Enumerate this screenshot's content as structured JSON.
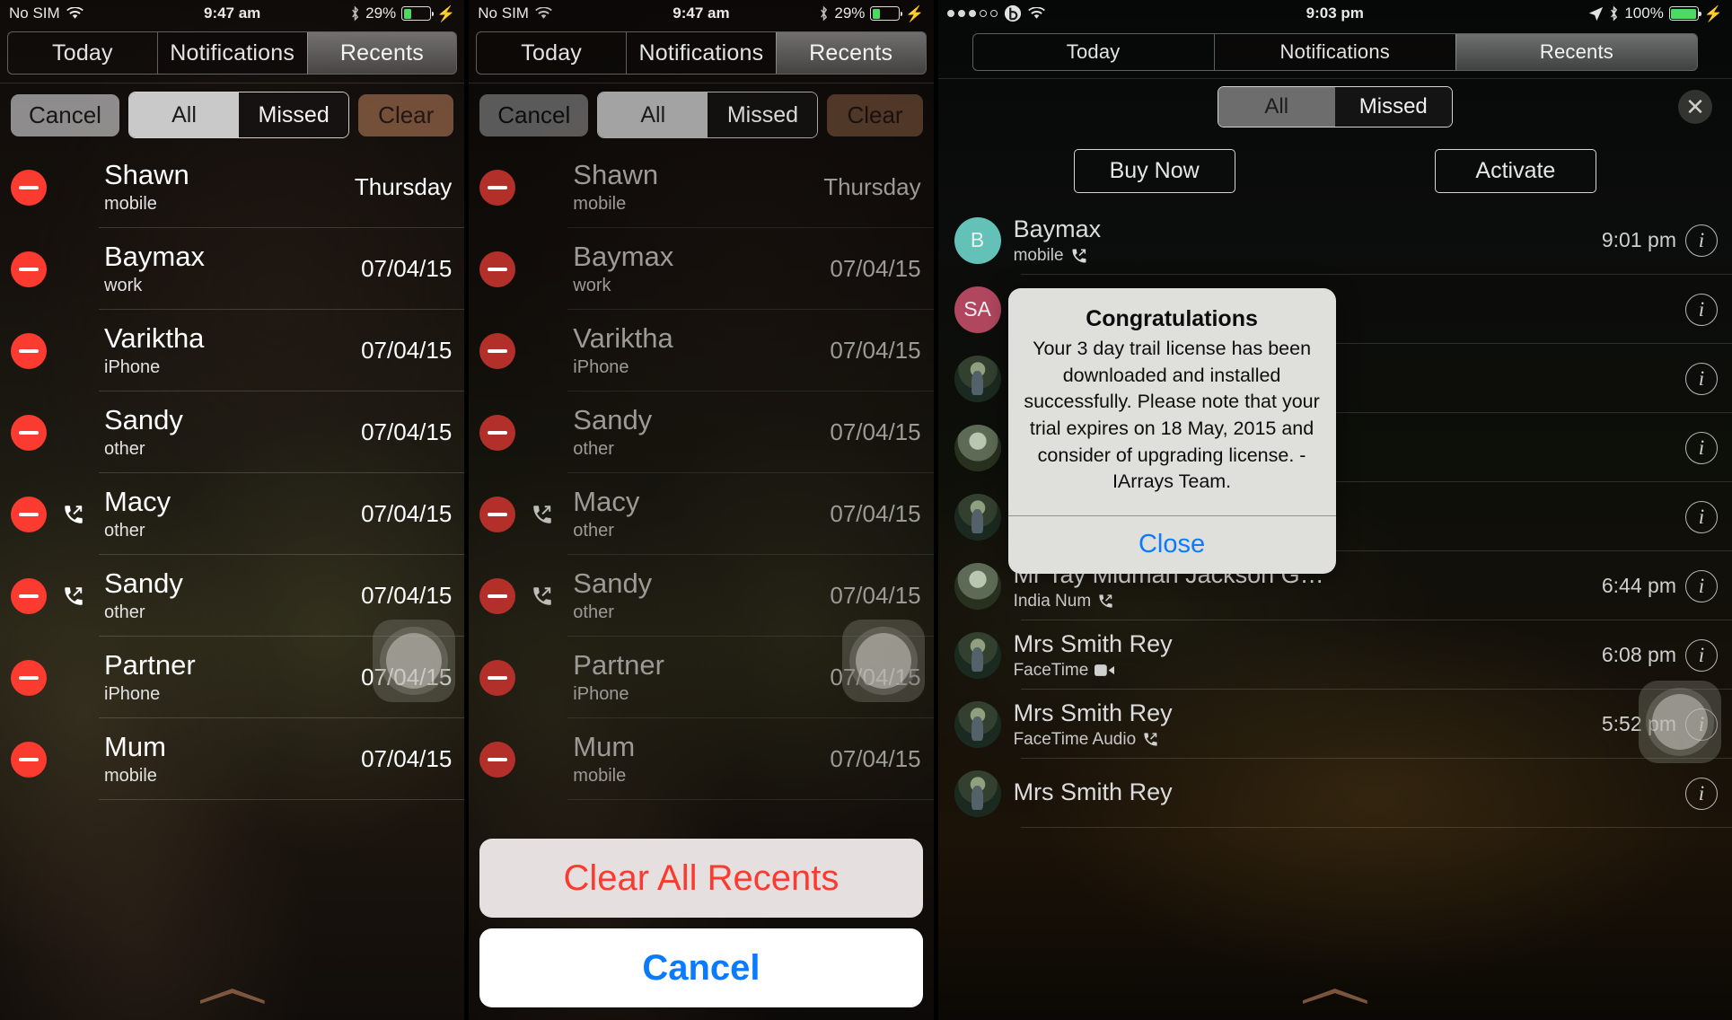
{
  "panels": [
    {
      "id": "panel-missed-edit",
      "status": {
        "carrier": "No SIM",
        "wifi_icon": "wifi-icon",
        "time": "9:47 am",
        "bluetooth_icon": "bluetooth-icon",
        "battery_text": "29%",
        "battery_level": 29,
        "charging_icon": "lightning-bolt-icon"
      },
      "tabs": [
        {
          "label": "Today",
          "selected": false
        },
        {
          "label": "Notifications",
          "selected": false
        },
        {
          "label": "Recents",
          "selected": true
        }
      ],
      "toolbar": {
        "cancel": "Cancel",
        "clear": "Clear",
        "segment": [
          {
            "label": "All",
            "selected": false
          },
          {
            "label": "Missed",
            "selected": true
          }
        ]
      },
      "calls": [
        {
          "name": "Shawn",
          "type": "mobile",
          "time": "Thursday",
          "direction": "none"
        },
        {
          "name": "Baymax",
          "type": "work",
          "time": "07/04/15",
          "direction": "none"
        },
        {
          "name": "Variktha",
          "type": "iPhone",
          "time": "07/04/15",
          "direction": "none"
        },
        {
          "name": "Sandy",
          "type": "other",
          "time": "07/04/15",
          "direction": "none"
        },
        {
          "name": "Macy",
          "type": "other",
          "time": "07/04/15",
          "direction": "outgoing"
        },
        {
          "name": "Sandy",
          "type": "other",
          "time": "07/04/15",
          "direction": "outgoing"
        },
        {
          "name": "Partner",
          "type": "iPhone",
          "time": "07/04/15",
          "direction": "none"
        },
        {
          "name": "Mum",
          "type": "mobile",
          "time": "07/04/15",
          "direction": "none"
        }
      ]
    },
    {
      "id": "panel-clear-confirm",
      "status": {
        "carrier": "No SIM",
        "wifi_icon": "wifi-icon",
        "time": "9:47 am",
        "bluetooth_icon": "bluetooth-icon",
        "battery_text": "29%",
        "battery_level": 29,
        "charging_icon": "lightning-bolt-icon"
      },
      "tabs": [
        {
          "label": "Today",
          "selected": false
        },
        {
          "label": "Notifications",
          "selected": false
        },
        {
          "label": "Recents",
          "selected": true
        }
      ],
      "toolbar": {
        "cancel": "Cancel",
        "clear": "Clear",
        "segment": [
          {
            "label": "All",
            "selected": false
          },
          {
            "label": "Missed",
            "selected": true
          }
        ]
      },
      "calls": [
        {
          "name": "Shawn",
          "type": "mobile",
          "time": "Thursday",
          "direction": "none"
        },
        {
          "name": "Baymax",
          "type": "work",
          "time": "07/04/15",
          "direction": "none"
        },
        {
          "name": "Variktha",
          "type": "iPhone",
          "time": "07/04/15",
          "direction": "none"
        },
        {
          "name": "Sandy",
          "type": "other",
          "time": "07/04/15",
          "direction": "none"
        },
        {
          "name": "Macy",
          "type": "other",
          "time": "07/04/15",
          "direction": "outgoing"
        },
        {
          "name": "Sandy",
          "type": "other",
          "time": "07/04/15",
          "direction": "outgoing"
        },
        {
          "name": "Partner",
          "type": "iPhone",
          "time": "07/04/15",
          "direction": "none"
        },
        {
          "name": "Mum",
          "type": "mobile",
          "time": "07/04/15",
          "direction": "none"
        }
      ],
      "action_sheet": {
        "destructive": "Clear All Recents",
        "cancel": "Cancel"
      }
    },
    {
      "id": "panel-license-alert",
      "status": {
        "signal_dots_filled": 3,
        "signal_dots_total": 5,
        "beats_icon": "beats-logo-icon",
        "wifi_icon": "wifi-icon",
        "time": "9:03 pm",
        "location_icon": "location-arrow-icon",
        "bluetooth_icon": "bluetooth-icon",
        "battery_text": "100%",
        "battery_level": 100,
        "charging_icon": "lightning-bolt-icon"
      },
      "tabs": [
        {
          "label": "Today",
          "selected": false
        },
        {
          "label": "Notifications",
          "selected": false
        },
        {
          "label": "Recents",
          "selected": true
        }
      ],
      "filter": {
        "segment": [
          {
            "label": "All",
            "selected": true
          },
          {
            "label": "Missed",
            "selected": false
          }
        ],
        "close_icon": "close-x-icon"
      },
      "license_buttons": [
        {
          "label": "Buy Now"
        },
        {
          "label": "Activate"
        }
      ],
      "calls": [
        {
          "name": "Baymax",
          "type": "mobile",
          "time": "9:01 pm",
          "direction": "outgoing",
          "avatar_kind": "initials",
          "avatar_text": "B",
          "avatar_color": "#63c1b8"
        },
        {
          "name": "",
          "type": "",
          "time": "",
          "direction": "none",
          "avatar_kind": "initials",
          "avatar_text": "SA",
          "avatar_color": "#b1475f"
        },
        {
          "name": "",
          "type": "",
          "time": "",
          "direction": "none",
          "avatar_kind": "photo"
        },
        {
          "name": "",
          "type": "",
          "time": "",
          "direction": "none",
          "avatar_kind": "photo2"
        },
        {
          "name": "",
          "type": "",
          "time": "",
          "direction": "none",
          "avatar_kind": "photo"
        },
        {
          "name": "Mr Tay Midman Jackson G…",
          "type": "India Num",
          "time": "6:44 pm",
          "direction": "outgoing",
          "avatar_kind": "photo2"
        },
        {
          "name": "Mrs Smith Rey",
          "type": "FaceTime",
          "time": "6:08 pm",
          "direction": "video",
          "avatar_kind": "photo"
        },
        {
          "name": "Mrs Smith Rey",
          "type": "FaceTime Audio",
          "time": "5:52 pm",
          "direction": "outgoing",
          "avatar_kind": "photo"
        },
        {
          "name": "Mrs Smith Rey",
          "type": "",
          "time": "",
          "direction": "none",
          "avatar_kind": "photo"
        }
      ],
      "alert": {
        "title": "Congratulations",
        "message": "Your 3 day trail license has been downloaded and installed successfully. Please note that your trial expires on 18 May, 2015 and consider of upgrading license.\n-IArrays Team.",
        "button": "Close"
      }
    }
  ],
  "colors": {
    "delete_red": "#fc3b30",
    "destructive_red": "#fb3b30",
    "action_blue": "#0a7bff",
    "battery_green": "#4cd964",
    "avatar_teal": "#63c1b8",
    "avatar_maroon": "#b1475f"
  }
}
